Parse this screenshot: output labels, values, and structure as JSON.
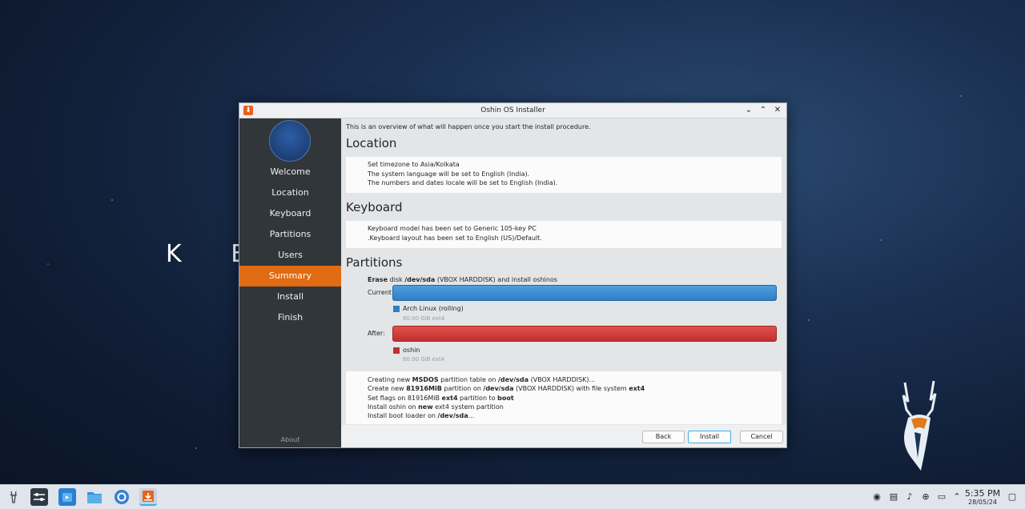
{
  "desktop": {
    "brand_text": "K E",
    "accent": "#e06b12"
  },
  "window": {
    "title": "Oshin OS Installer",
    "controls": [
      "chevron-down",
      "chevron-up",
      "close"
    ]
  },
  "sidebar": {
    "items": [
      {
        "label": "Welcome",
        "active": false
      },
      {
        "label": "Location",
        "active": false
      },
      {
        "label": "Keyboard",
        "active": false
      },
      {
        "label": "Partitions",
        "active": false
      },
      {
        "label": "Users",
        "active": false
      },
      {
        "label": "Summary",
        "active": true
      },
      {
        "label": "Install",
        "active": false
      },
      {
        "label": "Finish",
        "active": false
      }
    ],
    "about": "About"
  },
  "content": {
    "intro": "This is an overview of what will happen once you start the install procedure.",
    "location": {
      "heading": "Location",
      "lines": [
        "Set timezone to Asia/Kolkata",
        "The system language will be set to English (India).",
        "The numbers and dates locale will be set to English (India)."
      ]
    },
    "keyboard": {
      "heading": "Keyboard",
      "lines": [
        "Keyboard model has been set to Generic 105-key PC",
        ".Keyboard layout has been set to English (US)/Default."
      ]
    },
    "partitions": {
      "heading": "Partitions",
      "erase_bold": "Erase",
      "erase_mid": " disk ",
      "erase_dev": "/dev/sda",
      "erase_rest": " (VBOX HARDDISK) and install oshinos",
      "current_label": "Current:",
      "after_label": "After:",
      "current_legend": "Arch Linux (rolling)",
      "current_sub": "80.00 GiB  ext4",
      "after_legend": "oshin",
      "after_sub": "80.00 GiB  ext4",
      "current_color": "#2f7fc4",
      "after_color": "#c03030"
    },
    "operations": {
      "l1_a": "Creating new ",
      "l1_b": "MSDOS",
      "l1_c": " partition table on ",
      "l1_d": "/dev/sda",
      "l1_e": " (VBOX HARDDISK)...",
      "l2_a": "Create new ",
      "l2_b": "81916MiB",
      "l2_c": " partition on ",
      "l2_d": "/dev/sda",
      "l2_e": " (VBOX HARDDISK) with file system ",
      "l2_f": "ext4",
      "l3_a": "Set flags on 81916MiB ",
      "l3_b": "ext4",
      "l3_c": " partition to ",
      "l3_d": "boot",
      "l4_a": "Install oshin on ",
      "l4_b": "new",
      "l4_c": " ext4 system partition",
      "l5_a": "Install boot loader on ",
      "l5_b": "/dev/sda",
      "l5_c": "..."
    }
  },
  "buttons": {
    "back": "Back",
    "install": "Install",
    "cancel": "Cancel"
  },
  "taskbar": {
    "apps": [
      "launcher-icon",
      "system-settings-icon",
      "discover-store-icon",
      "file-manager-icon",
      "chromium-browser-icon",
      "installer-icon"
    ],
    "tray": [
      "network-share-icon",
      "clipboard-icon",
      "volume-icon",
      "updates-icon",
      "network-icon",
      "expand-tray-icon"
    ],
    "time": "5:35 PM",
    "date": "28/05/24"
  }
}
